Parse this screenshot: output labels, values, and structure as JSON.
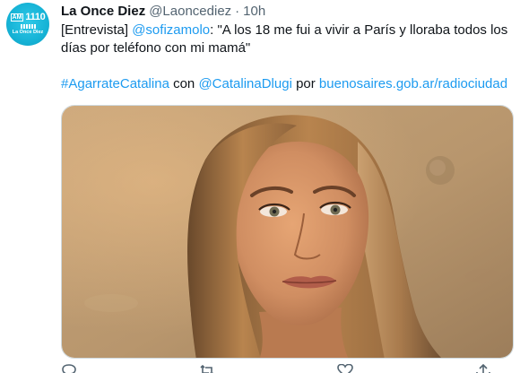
{
  "tweet": {
    "display_name": "La Once Diez",
    "handle": "@Laoncediez",
    "separator": "·",
    "time": "10h",
    "avatar": {
      "am": "AM",
      "frequency": "1110",
      "name": "La Once Diez",
      "color": "#16b3d6"
    },
    "line1_prefix": "[Entrevista] ",
    "mention_1": "@sofizamolo",
    "line1_quote": ": \"A los 18 me fui a vivir a París y lloraba todos los días por teléfono con mi mamá\"",
    "hashtag": "#AgarrateCatalina",
    "con": " con ",
    "mention_2": "@CatalinaDlugi",
    "por": " por ",
    "url": "buenosaires.gob.ar/radiociudad",
    "media_icon": "portrait-photo",
    "link_color": "#1d9bf0"
  },
  "actions": {
    "reply_icon": "reply-icon",
    "retweet_icon": "retweet-icon",
    "like_icon": "like-icon",
    "share_icon": "share-icon"
  }
}
